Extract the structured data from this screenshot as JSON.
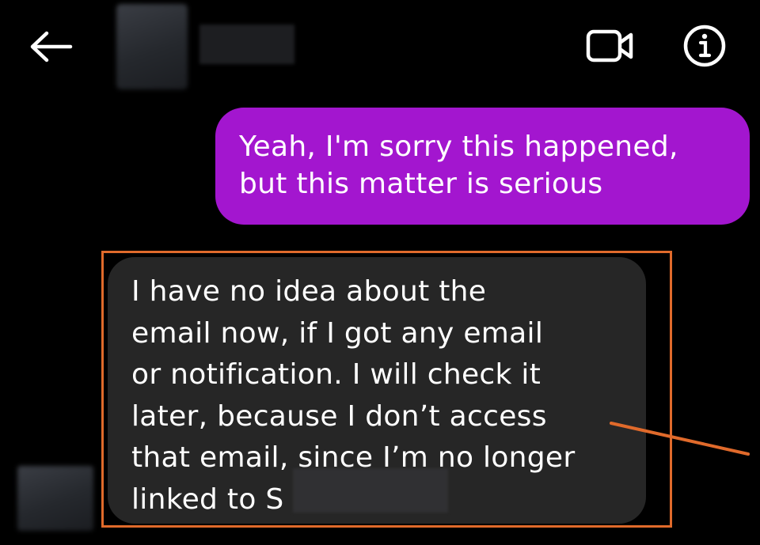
{
  "header": {
    "back_icon": "arrow-left-icon",
    "video_icon": "video-camera-icon",
    "info_icon": "info-icon"
  },
  "messages": [
    {
      "direction": "outgoing",
      "text": "Yeah, I'm sorry this happened,\nbut this matter is serious",
      "bubble_color": "#a316cf"
    },
    {
      "direction": "incoming",
      "text": "I have no idea about the\nemail now, if I got any email\nor notification. I will check it\nlater, because I don’t access\nthat email, since I’m no longer\nlinked to S",
      "bubble_color": "#262626"
    }
  ],
  "annotation": {
    "highlight_color": "#e06a2b"
  }
}
